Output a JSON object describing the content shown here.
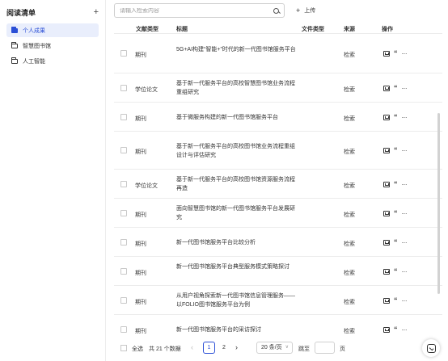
{
  "sidebar": {
    "title": "阅读清单",
    "items": [
      {
        "label": "个人成果",
        "active": true
      },
      {
        "label": "智慧图书馆",
        "active": false
      },
      {
        "label": "人工智能",
        "active": false
      }
    ]
  },
  "toolbar": {
    "search_placeholder": "请输入检索内容",
    "upload_label": "上传"
  },
  "table": {
    "headers": {
      "doc_type": "文献类型",
      "title": "标题",
      "file_type": "文件类型",
      "source": "来源",
      "actions": "操作"
    },
    "rows": [
      {
        "doc_type": "期刊",
        "title": "5G+AI构建“智能+”时代的新一代图书馆服务平台",
        "file_type": "",
        "source": "检索"
      },
      {
        "doc_type": "学位论文",
        "title": "基于新一代服务平台的高校智慧图书馆业务流程重组研究",
        "file_type": "",
        "source": "检索"
      },
      {
        "doc_type": "期刊",
        "title": "基于微服务构建的新一代图书馆服务平台",
        "file_type": "",
        "source": "检索"
      },
      {
        "doc_type": "期刊",
        "title": "基于新一代服务平台的高校图书馆业务流程重组设计与评估研究",
        "file_type": "",
        "source": "检索"
      },
      {
        "doc_type": "学位论文",
        "title": "基于新一代服务平台的高校图书馆资源服务流程再造",
        "file_type": "",
        "source": "检索"
      },
      {
        "doc_type": "期刊",
        "title": "面向智慧图书馆的新一代图书馆服务平台发展研究",
        "file_type": "",
        "source": "检索"
      },
      {
        "doc_type": "期刊",
        "title": "新一代图书馆服务平台比较分析",
        "file_type": "",
        "source": "检索"
      },
      {
        "doc_type": "期刊",
        "title": "新一代图书馆服务平台典型服务模式策略探讨",
        "file_type": "",
        "source": "检索"
      },
      {
        "doc_type": "期刊",
        "title": "从用户视角探索新一代图书馆信息管理服务——以FOLIO图书馆服务平台为例",
        "file_type": "",
        "source": "检索"
      },
      {
        "doc_type": "期刊",
        "title": "新一代图书馆服务平台的采访探讨",
        "file_type": "",
        "source": "检索"
      }
    ]
  },
  "pagination": {
    "select_all": "全选",
    "total": "共 21 个数据",
    "prev": "‹",
    "next": "›",
    "pages": [
      "1",
      "2"
    ],
    "current_page": "1",
    "page_size": "20 条/页",
    "jump_label": "跳至",
    "page_label": "页"
  },
  "icons": {
    "action_1": "folder-export-icon",
    "action_2": "quote-icon",
    "action_3": "more-icon",
    "fab": "check-edit-icon"
  },
  "colors": {
    "accent": "#2b4fd6",
    "active_bg": "#e9eefc"
  }
}
